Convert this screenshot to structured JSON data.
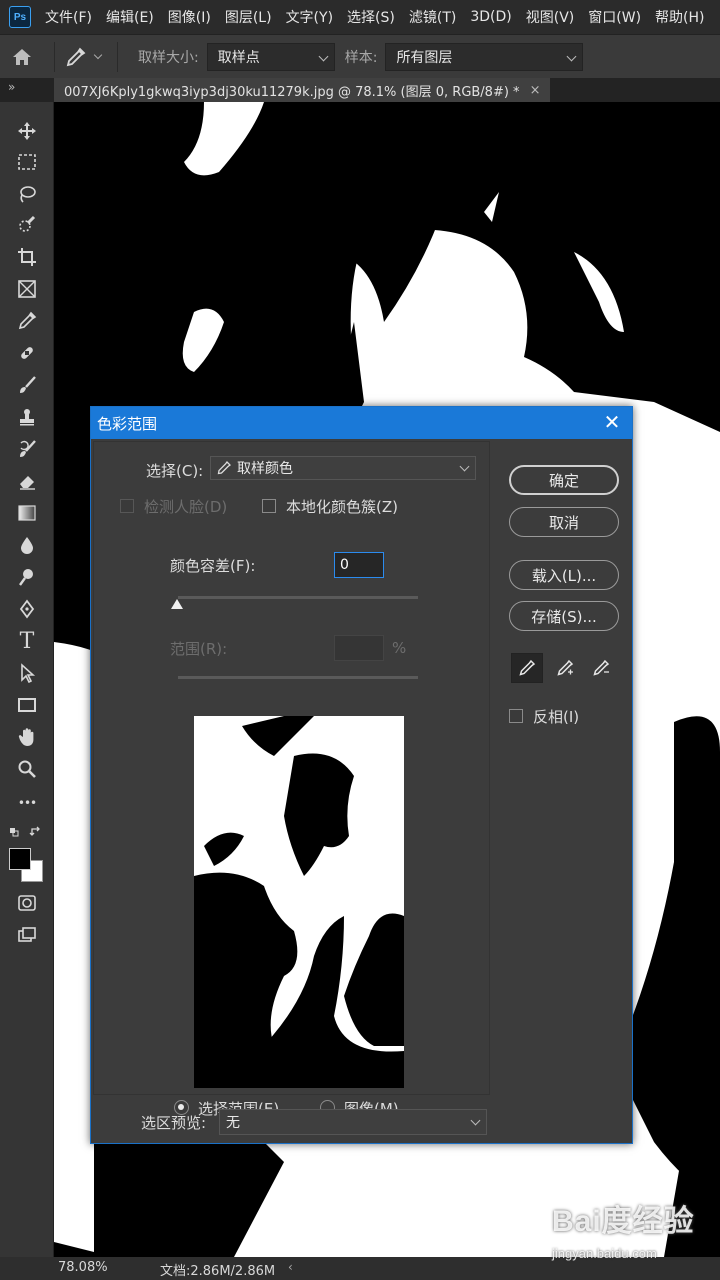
{
  "menubar": {
    "logo": "Ps",
    "items": [
      "文件(F)",
      "编辑(E)",
      "图像(I)",
      "图层(L)",
      "文字(Y)",
      "选择(S)",
      "滤镜(T)",
      "3D(D)",
      "视图(V)",
      "窗口(W)",
      "帮助(H)"
    ]
  },
  "options": {
    "sample_size_label": "取样大小:",
    "sample_size_value": "取样点",
    "sample_label": "样本:",
    "sample_value": "所有图层"
  },
  "tab": {
    "title": "007XJ6Kply1gkwq3iyp3dj30ku11279k.jpg @ 78.1% (图层 0, RGB/8#) *",
    "close": "×",
    "collapse": "»"
  },
  "toolbar": {
    "tools": [
      "move-tool",
      "marquee-tool",
      "lasso-tool",
      "quick-select-tool",
      "crop-tool",
      "frame-tool",
      "eyedropper-tool",
      "healing-brush-tool",
      "brush-tool",
      "clone-stamp-tool",
      "history-brush-tool",
      "eraser-tool",
      "gradient-tool",
      "blur-tool",
      "dodge-tool",
      "pen-tool",
      "type-tool",
      "path-select-tool",
      "rectangle-tool",
      "hand-tool",
      "zoom-tool",
      "more-tools",
      "quick-mask-tool",
      "screen-mode-tool"
    ],
    "type_glyph": "T",
    "more_glyph": "•••",
    "foreground_color": "#000000",
    "background_color": "#ffffff"
  },
  "status": {
    "zoom": "78.08%",
    "doc": "文档:2.86M/2.86M",
    "arrow": "‹"
  },
  "watermark": {
    "logo": "Bai度经验",
    "url": "jingyan.baidu.com"
  },
  "dialog": {
    "title": "色彩范围",
    "close": "✕",
    "select_label": "选择(C):",
    "select_value": "取样颜色",
    "detect_faces": "检测人脸(D)",
    "localized": "本地化颜色簇(Z)",
    "fuzziness_label": "颜色容差(F):",
    "fuzziness_value": "0",
    "range_label": "范围(R):",
    "range_unit": "%",
    "radio_selection": "选择范围(E)",
    "radio_image": "图像(M)",
    "selection_preview_label": "选区预览:",
    "selection_preview_value": "无",
    "buttons": {
      "ok": "确定",
      "cancel": "取消",
      "load": "载入(L)...",
      "save": "存储(S)..."
    },
    "invert": "反相(I)"
  }
}
